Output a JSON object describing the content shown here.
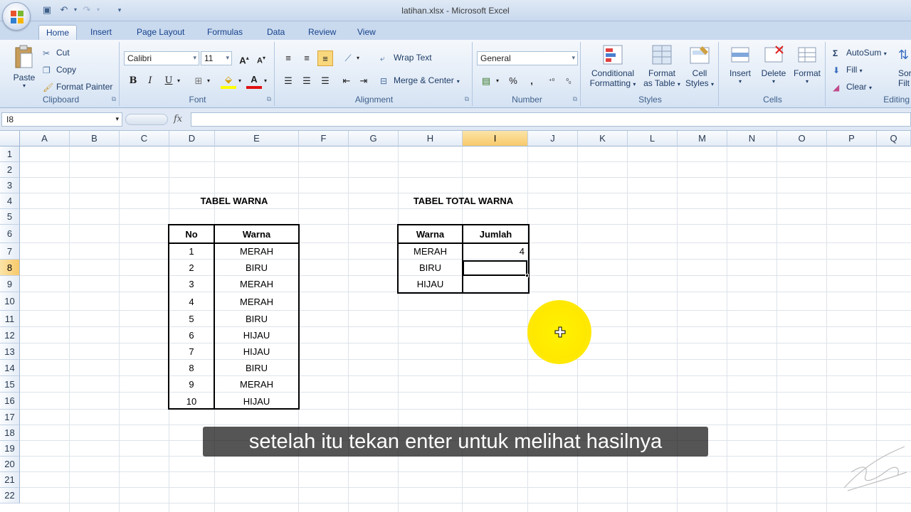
{
  "window": {
    "title": "latihan.xlsx - Microsoft Excel"
  },
  "tabs": [
    "Home",
    "Insert",
    "Page Layout",
    "Formulas",
    "Data",
    "Review",
    "View"
  ],
  "ribbon": {
    "clipboard": {
      "label": "Clipboard",
      "paste": "Paste",
      "cut": "Cut",
      "copy": "Copy",
      "format_painter": "Format Painter"
    },
    "font": {
      "label": "Font",
      "name": "Calibri",
      "size": "11",
      "bold": "B",
      "italic": "I",
      "underline": "U"
    },
    "alignment": {
      "label": "Alignment",
      "wrap_text": "Wrap Text",
      "merge_center": "Merge & Center"
    },
    "number": {
      "label": "Number",
      "format": "General",
      "percent": "%",
      "comma": ","
    },
    "styles": {
      "label": "Styles",
      "conditional_1": "Conditional",
      "conditional_2": "Formatting",
      "format_table_1": "Format",
      "format_table_2": "as Table",
      "cell_styles_1": "Cell",
      "cell_styles_2": "Styles"
    },
    "cells": {
      "label": "Cells",
      "insert": "Insert",
      "delete": "Delete",
      "format": "Format"
    },
    "editing": {
      "label": "Editing",
      "autosum": "AutoSum",
      "fill": "Fill",
      "clear": "Clear",
      "sort_1": "Sor",
      "sort_2": "Filt"
    }
  },
  "formula_bar": {
    "name_box": "I8",
    "fx": "fx",
    "formula": ""
  },
  "columns": [
    "A",
    "B",
    "C",
    "D",
    "E",
    "F",
    "G",
    "H",
    "I",
    "J",
    "K",
    "L",
    "M",
    "N",
    "O",
    "P",
    "Q"
  ],
  "selected_column": "I",
  "rows": [
    "1",
    "2",
    "3",
    "4",
    "5",
    "6",
    "7",
    "8",
    "9",
    "10",
    "11",
    "12",
    "13",
    "14",
    "15",
    "16",
    "17",
    "18",
    "19",
    "20",
    "21",
    "22"
  ],
  "selected_row": "8",
  "sheet": {
    "tabel_warna": {
      "title": "TABEL WARNA",
      "headers": [
        "No",
        "Warna"
      ],
      "rows": [
        [
          "1",
          "MERAH"
        ],
        [
          "2",
          "BIRU"
        ],
        [
          "3",
          "MERAH"
        ],
        [
          "4",
          "MERAH"
        ],
        [
          "5",
          "BIRU"
        ],
        [
          "6",
          "HIJAU"
        ],
        [
          "7",
          "HIJAU"
        ],
        [
          "8",
          "BIRU"
        ],
        [
          "9",
          "MERAH"
        ],
        [
          "10",
          "HIJAU"
        ]
      ]
    },
    "tabel_total": {
      "title": "TABEL TOTAL WARNA",
      "headers": [
        "Warna",
        "Jumlah"
      ],
      "rows": [
        [
          "MERAH",
          "4"
        ],
        [
          "BIRU",
          ""
        ],
        [
          "HIJAU",
          ""
        ]
      ]
    }
  },
  "subtitle": "setelah itu tekan enter untuk melihat hasilnya",
  "colors": {
    "highlight": "#fff200",
    "selected_header": "#f8c96a"
  }
}
